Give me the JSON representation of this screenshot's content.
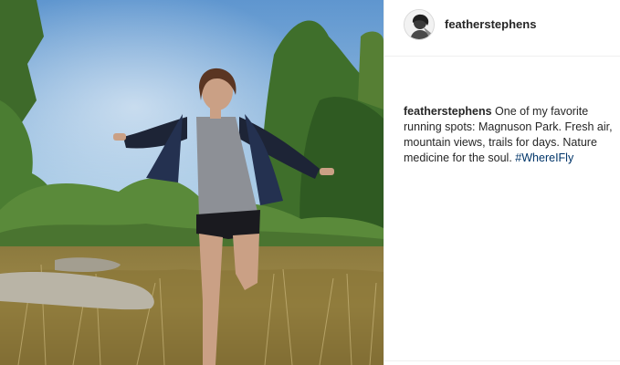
{
  "post": {
    "username": "featherstephens",
    "caption_username": "featherstephens",
    "caption_text": "One of my favorite running spots: Magnuson Park. Fresh air, mountain views, trails for days. Nature medicine for the soul.",
    "hashtag": "#WhereIFly",
    "avatar_icon": "profile-avatar",
    "photo_icon": "runner-in-field-photo"
  },
  "colors": {
    "username": "#262626",
    "hashtag": "#003569",
    "divider": "#efefef"
  }
}
